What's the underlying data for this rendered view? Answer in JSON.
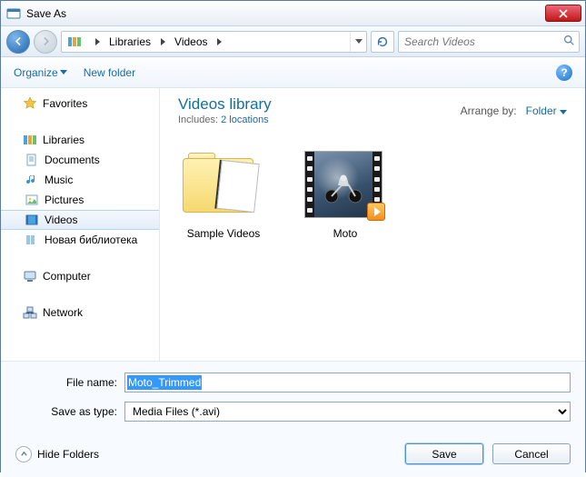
{
  "window": {
    "title": "Save As"
  },
  "nav": {
    "breadcrumb": [
      "Libraries",
      "Videos"
    ],
    "search_placeholder": "Search Videos"
  },
  "toolbar": {
    "organize": "Organize",
    "new_folder": "New folder"
  },
  "sidebar": {
    "favorites": "Favorites",
    "libraries": "Libraries",
    "lib_children": [
      "Documents",
      "Music",
      "Pictures",
      "Videos",
      "Новая библиотека"
    ],
    "selected_child_index": 3,
    "computer": "Computer",
    "network": "Network"
  },
  "main": {
    "title": "Videos library",
    "includes_prefix": "Includes:",
    "includes_link": "2 locations",
    "arrange_label": "Arrange by:",
    "arrange_value": "Folder",
    "items": [
      {
        "label": "Sample Videos",
        "kind": "folder"
      },
      {
        "label": "Moto",
        "kind": "video"
      }
    ]
  },
  "form": {
    "filename_label": "File name:",
    "filename_value": "Moto_Trimmed",
    "type_label": "Save as type:",
    "type_value": "Media Files (*.avi)"
  },
  "bottom": {
    "hide_folders": "Hide Folders",
    "save": "Save",
    "cancel": "Cancel"
  }
}
